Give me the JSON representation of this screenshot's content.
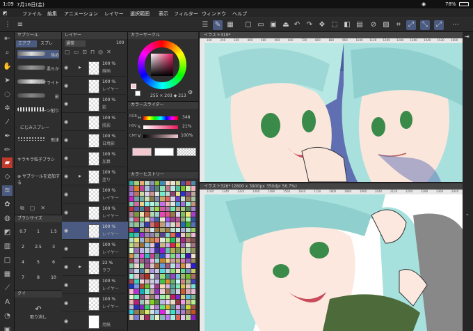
{
  "status": {
    "time": "1:09",
    "date": "7月16日(金)",
    "battery": "78%"
  },
  "menu": [
    "ファイル",
    "編集",
    "アニメーション",
    "レイヤー",
    "選択範囲",
    "表示",
    "フィルター",
    "ウィンドウ",
    "ヘルプ"
  ],
  "subtool": {
    "tabs": [
      "エアブ",
      "スプレ"
    ],
    "items": [
      "強め",
      "柔らか",
      "ハイライト",
      "影",
      "トーン削り",
      "にじみスプレー",
      "飛沫",
      "キラキラ粒子ブラシ"
    ],
    "add_label": "サブツールを追加する",
    "panel_title": "サブツール"
  },
  "brushsize": {
    "title": "ブラシサイズ",
    "sizes": [
      "0.7",
      "1",
      "1.5",
      "2",
      "2.5",
      "3",
      "4",
      "5",
      "6",
      "7",
      "8",
      "10"
    ]
  },
  "undo": {
    "panel_title": "クイ",
    "label": "取り消し"
  },
  "layers": {
    "title": "レイヤー",
    "blend": "通常",
    "opacity": "100",
    "items": [
      {
        "pct": "100 %",
        "name": "線画",
        "folder": true
      },
      {
        "pct": "100 %",
        "name": "レイヤー"
      },
      {
        "pct": "100 %",
        "name": "影"
      },
      {
        "pct": "100 %",
        "name": "肌影"
      },
      {
        "pct": "100 %",
        "name": "日焼影"
      },
      {
        "pct": "100 %",
        "name": "加算"
      },
      {
        "pct": "100 %",
        "name": "塗り",
        "folder": true
      },
      {
        "pct": "100 %",
        "name": "レイヤー"
      },
      {
        "pct": "100 %",
        "name": "レイヤー"
      },
      {
        "pct": "100 %",
        "name": "レイヤー",
        "selected": true
      },
      {
        "pct": "100 %",
        "name": "レイヤー"
      },
      {
        "pct": "22 %",
        "name": "ラフ",
        "folder": true
      },
      {
        "pct": "100 %",
        "name": "レイヤー"
      },
      {
        "pct": "100 %",
        "name": "レイヤー"
      },
      {
        "pct": "",
        "name": "用紙"
      }
    ]
  },
  "color_circle": {
    "title": "カラーサークル",
    "values": [
      "255",
      "203",
      "213"
    ]
  },
  "color_slider": {
    "title": "カラースライダー",
    "rows": [
      {
        "label": "H",
        "value": "348"
      },
      {
        "label": "S",
        "value": "21%"
      },
      {
        "label": "V",
        "value": "100%"
      }
    ],
    "side_tabs": [
      "RGB",
      "HSV",
      "CMY"
    ]
  },
  "color_history": {
    "title": "カラーヒストリー"
  },
  "canvas1": {
    "title": "イラスト319*",
    "ruler": [
      "160",
      "240",
      "320",
      "400",
      "480",
      "560",
      "640",
      "720",
      "800",
      "880",
      "960",
      "1040",
      "1120",
      "1200",
      "1280",
      "1360",
      "1440",
      "1520",
      "1600"
    ]
  },
  "canvas2": {
    "title": "イラスト326* (2800 x 3900px 350dpi 56.7%)",
    "ruler": [
      "1160",
      "1240",
      "1320",
      "1400",
      "1480",
      "1560",
      "1640",
      "1720",
      "1800",
      "1880",
      "1960",
      "2040",
      "2120",
      "2200",
      "2280",
      "2360",
      "2440"
    ]
  },
  "colors": {
    "accent": "#4a5a80",
    "main_color": "#f4cad2"
  }
}
